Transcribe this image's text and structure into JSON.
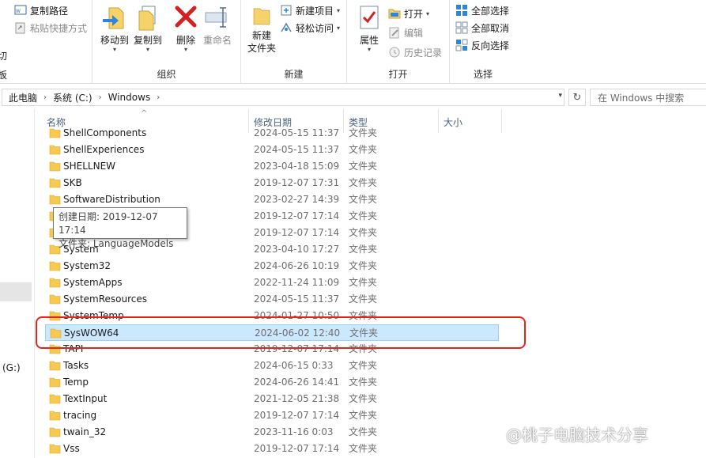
{
  "ribbon": {
    "clipboard": {
      "copy_path": "复制路径",
      "paste_shortcut": "粘贴快捷方式",
      "cut_partial": "切",
      "group_partial": "板"
    },
    "organize": {
      "move_to": "移动到",
      "copy_to": "复制到",
      "delete": "删除",
      "rename": "重命名",
      "label": "组织"
    },
    "new": {
      "new_folder": "新建\n文件夹",
      "new_item": "新建项目",
      "easy_access": "轻松访问",
      "label": "新建"
    },
    "open": {
      "properties": "属性",
      "open": "打开",
      "edit": "编辑",
      "history": "历史记录",
      "label": "打开"
    },
    "select": {
      "select_all": "全部选择",
      "select_none": "全部取消",
      "invert": "反向选择",
      "label": "选择"
    }
  },
  "address": {
    "crumbs": [
      "此电脑",
      "系统 (C:)",
      "Windows"
    ],
    "search_placeholder": "在 Windows 中搜索"
  },
  "nav": {
    "drive_partial": "(G:)"
  },
  "columns": {
    "name": "名称",
    "date": "修改日期",
    "type": "类型",
    "size": "大小"
  },
  "files": [
    {
      "name": "ShellComponents",
      "date": "2024-05-15 11:37",
      "type": "文件夹"
    },
    {
      "name": "ShellExperiences",
      "date": "2024-05-15 11:37",
      "type": "文件夹"
    },
    {
      "name": "SHELLNEW",
      "date": "2023-04-18 15:09",
      "type": "文件夹"
    },
    {
      "name": "SKB",
      "date": "2019-12-07 17:31",
      "type": "文件夹"
    },
    {
      "name": "SoftwareDistribution",
      "date": "2023-02-27 14:39",
      "type": "文件夹"
    },
    {
      "name": "",
      "date": "2019-12-07 17:14",
      "type": "文件夹"
    },
    {
      "name": "",
      "date": "2019-12-07 17:14",
      "type": "文件夹"
    },
    {
      "name": "System",
      "date": "2023-04-10 17:27",
      "type": "文件夹"
    },
    {
      "name": "System32",
      "date": "2024-06-26 10:19",
      "type": "文件夹"
    },
    {
      "name": "SystemApps",
      "date": "2022-11-24 11:09",
      "type": "文件夹"
    },
    {
      "name": "SystemResources",
      "date": "2024-05-15 11:37",
      "type": "文件夹"
    },
    {
      "name": "SystemTemp",
      "date": "2024-01-27 10:50",
      "type": "文件夹"
    },
    {
      "name": "SysWOW64",
      "date": "2024-06-02 12:40",
      "type": "文件夹"
    },
    {
      "name": "TAPI",
      "date": "2019-12-07 17:14",
      "type": "文件夹"
    },
    {
      "name": "Tasks",
      "date": "2024-06-15 0:33",
      "type": "文件夹"
    },
    {
      "name": "Temp",
      "date": "2024-06-26 14:41",
      "type": "文件夹"
    },
    {
      "name": "TextInput",
      "date": "2021-12-05 21:38",
      "type": "文件夹"
    },
    {
      "name": "tracing",
      "date": "2019-12-07 17:14",
      "type": "文件夹"
    },
    {
      "name": "twain_32",
      "date": "2023-11-16 0:03",
      "type": "文件夹"
    },
    {
      "name": "Vss",
      "date": "2019-12-07 17:14",
      "type": "文件夹"
    }
  ],
  "selected_file": "SysWOW64",
  "tooltip": {
    "line1": "创建日期: 2019-12-07 17:14",
    "line2": "文件夹: LanguageModels"
  },
  "watermark": "@桃子电脑技术分享",
  "colors": {
    "accent": "#0078d7",
    "selection_bg": "#cce8ff",
    "selection_border": "#99d1ff",
    "highlight_box": "#e0261e",
    "folder": "#f8c94f"
  }
}
